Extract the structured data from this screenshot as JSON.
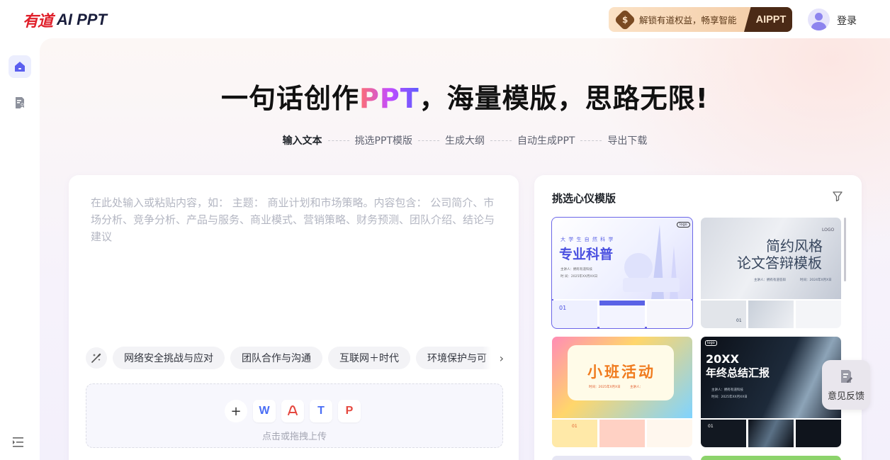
{
  "header": {
    "logo_cn": "有道",
    "logo_en": "AI PPT",
    "promo_icon": "$",
    "promo_text": "解锁有道权益，畅享智能",
    "promo_tag": "AIPPT",
    "login_label": "登录"
  },
  "sidebar": {
    "items": [
      {
        "name": "home",
        "icon": "home-icon"
      },
      {
        "name": "my-files",
        "icon": "file-user-icon"
      }
    ],
    "bottom_icon": "menu-collapse-icon"
  },
  "hero": {
    "prefix": "一句话创作",
    "highlight": "PPT",
    "suffix": "，海量模版，思路无限!"
  },
  "steps": [
    "输入文本",
    "挑选PPT模版",
    "生成大纲",
    "自动生成PPT",
    "导出下载"
  ],
  "input": {
    "placeholder": "在此处输入或粘贴内容，如： 主题： 商业计划和市场策略。内容包含： 公司简介、市场分析、竞争分析、产品与服务、商业模式、营销策略、财务预测、团队介绍、结论与建议",
    "chips": [
      "网络安全挑战与应对",
      "团队合作与沟通",
      "互联网＋时代",
      "环境保护与可"
    ],
    "upload_label": "点击或拖拽上传",
    "file_types": [
      {
        "label": "W",
        "color": "#4a6ef5",
        "icon": "word-icon"
      },
      {
        "label": "A",
        "color": "#e5483f",
        "icon": "pdf-icon"
      },
      {
        "label": "T",
        "color": "#4a6ef5",
        "icon": "text-icon"
      },
      {
        "label": "P",
        "color": "#e5483f",
        "icon": "ppt-icon"
      }
    ]
  },
  "templates": {
    "title": "挑选心仪模版",
    "items": [
      {
        "label_top": "大 学 生 自 然 科 学",
        "label_main": "专业科普",
        "meta1": "主讲人：拥有有道科技",
        "meta2": "时 间：2025年XX月XX日",
        "page": "01",
        "logo": "logo",
        "selected": true
      },
      {
        "label_top": "LOGO",
        "label_main": "简约风格",
        "label_sub": "论文答辩模板",
        "meta1": "主讲人：拥有有道答辩",
        "meta2": "时间：2024年X月X日",
        "page": "01",
        "selected": false
      },
      {
        "label_main": "小班活动",
        "meta1": "时间：2025年X月X日",
        "meta2": "主讲人：",
        "page": "01",
        "selected": false
      },
      {
        "label_top": "logo",
        "label_main": "20XX",
        "label_sub": "年终总结汇报",
        "meta1": "主讲人：拥有有道科技",
        "meta2": "时间：2025年XX月XX日",
        "page": "01",
        "selected": false
      }
    ]
  },
  "feedback_label": "意见反馈",
  "colors": {
    "accent": "#6b66e8",
    "brand_red": "#e0202b",
    "promo_dark": "#4b2a16"
  }
}
